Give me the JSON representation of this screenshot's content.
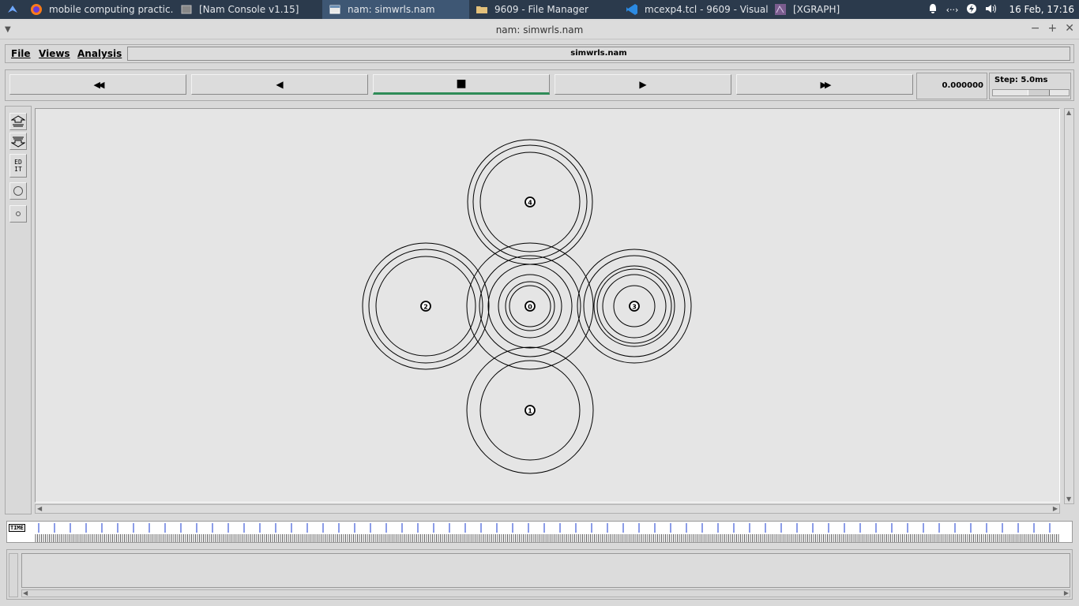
{
  "taskbar": {
    "tasks": [
      {
        "label": "mobile computing practic...",
        "icon": "firefox-icon"
      },
      {
        "label": "[Nam Console v1.15]",
        "icon": "window-icon"
      },
      {
        "label": "nam: simwrls.nam",
        "icon": "window-icon",
        "active": true
      },
      {
        "label": "9609 - File Manager",
        "icon": "folder-icon"
      },
      {
        "label": "mcexp4.tcl - 9609 - Visual ...",
        "icon": "vscode-icon"
      },
      {
        "label": "[XGRAPH]",
        "icon": "xgraph-icon"
      }
    ],
    "clock": "16 Feb, 17:16"
  },
  "window": {
    "title": "nam: simwrls.nam"
  },
  "menubar": {
    "file": "File",
    "views": "Views",
    "analysis": "Analysis",
    "filename": "simwrls.nam"
  },
  "controls": {
    "rewind": "◀◀",
    "back": "◀",
    "stop": "■",
    "play": "▶",
    "fastforward": "▶▶",
    "time": "0.000000",
    "step": "Step: 5.0ms"
  },
  "tools": {
    "edit": "ED\nIT"
  },
  "nodes": [
    {
      "id": "0"
    },
    {
      "id": "1"
    },
    {
      "id": "2"
    },
    {
      "id": "3"
    },
    {
      "id": "4"
    }
  ],
  "timeline": {
    "label": "TIME"
  }
}
